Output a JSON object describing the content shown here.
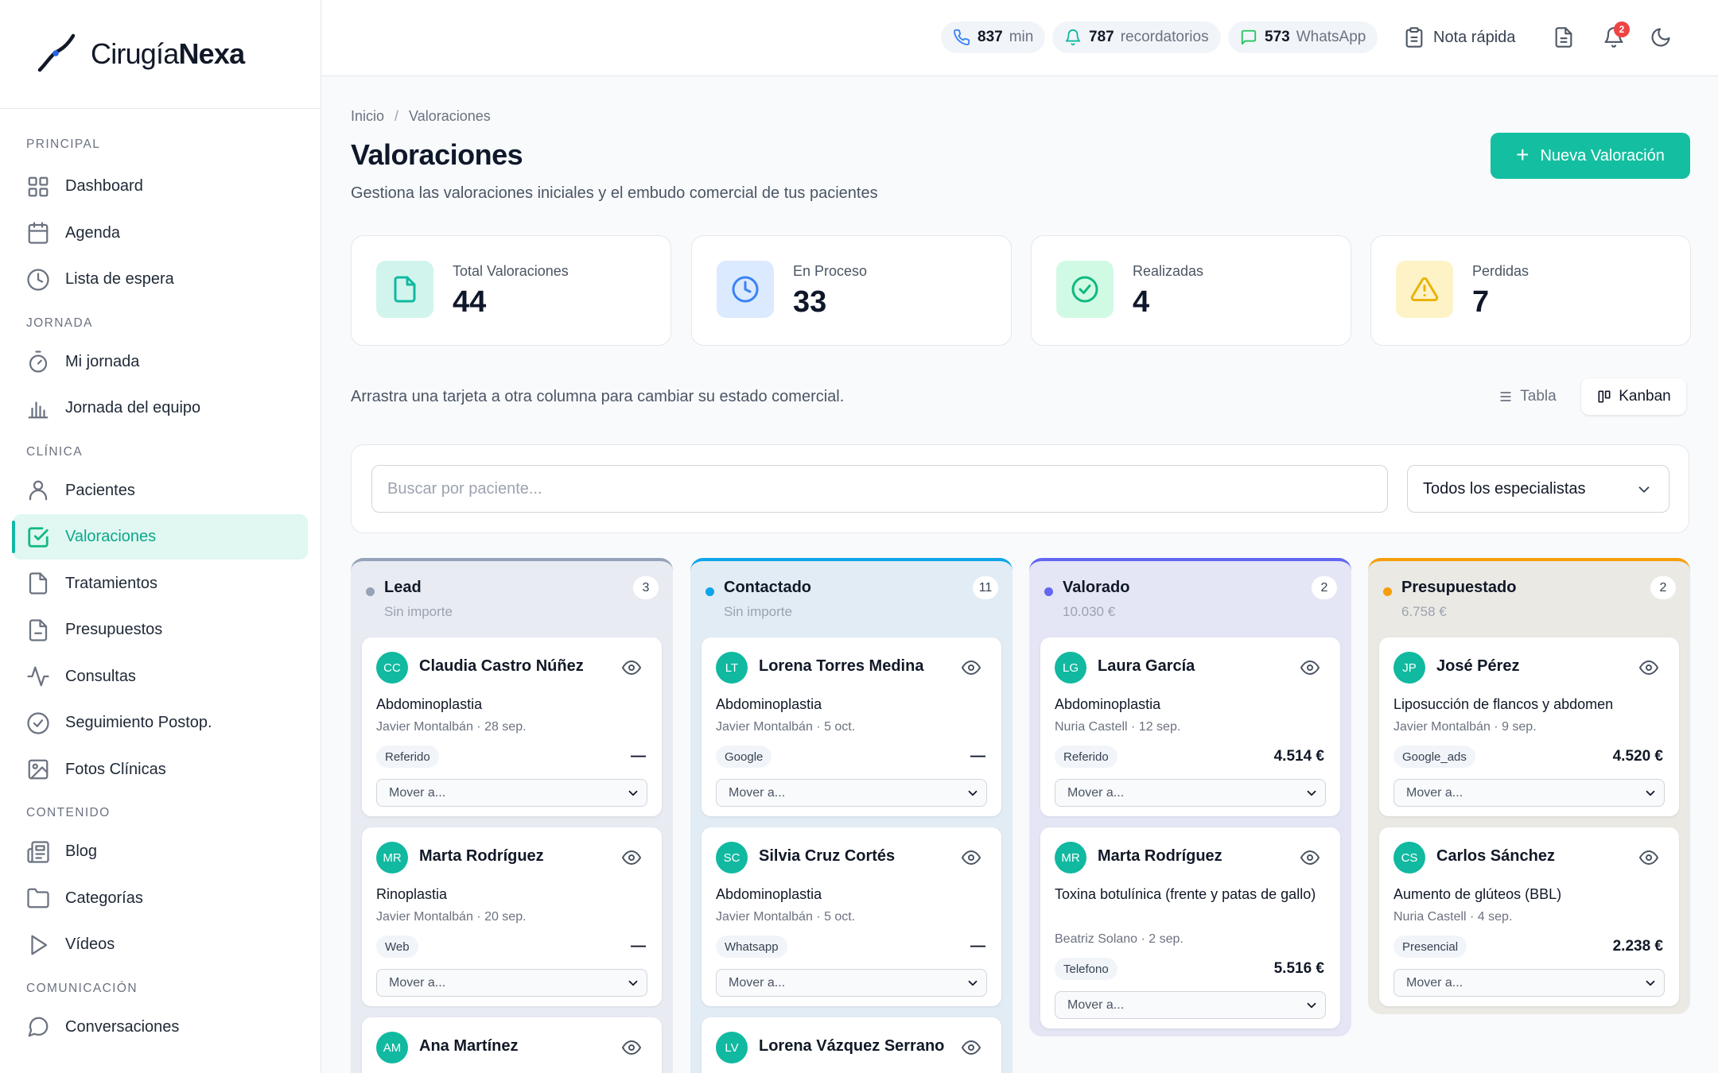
{
  "brand": {
    "name_light": "Cirugía",
    "name_bold": "Nexa"
  },
  "sidebar": {
    "sections": [
      {
        "title": "PRINCIPAL",
        "items": [
          {
            "label": "Dashboard",
            "icon": "dashboard-icon"
          },
          {
            "label": "Agenda",
            "icon": "calendar-icon"
          },
          {
            "label": "Lista de espera",
            "icon": "clock-icon"
          }
        ]
      },
      {
        "title": "JORNADA",
        "items": [
          {
            "label": "Mi jornada",
            "icon": "timer-icon"
          },
          {
            "label": "Jornada del equipo",
            "icon": "bar-chart-icon"
          }
        ]
      },
      {
        "title": "CLÍNICA",
        "items": [
          {
            "label": "Pacientes",
            "icon": "user-icon"
          },
          {
            "label": "Valoraciones",
            "icon": "check-square-icon",
            "active": true
          },
          {
            "label": "Tratamientos",
            "icon": "file-icon"
          },
          {
            "label": "Presupuestos",
            "icon": "file-minus-icon"
          },
          {
            "label": "Consultas",
            "icon": "activity-icon"
          },
          {
            "label": "Seguimiento Postop.",
            "icon": "check-circle-icon"
          },
          {
            "label": "Fotos Clínicas",
            "icon": "image-icon"
          }
        ]
      },
      {
        "title": "CONTENIDO",
        "items": [
          {
            "label": "Blog",
            "icon": "newspaper-icon"
          },
          {
            "label": "Categorías",
            "icon": "folder-icon"
          },
          {
            "label": "Vídeos",
            "icon": "play-icon"
          }
        ]
      },
      {
        "title": "COMUNICACIÓN",
        "items": [
          {
            "label": "Conversaciones",
            "icon": "chat-icon"
          }
        ]
      }
    ]
  },
  "topbar": {
    "minutes": {
      "value": "837",
      "unit": "min"
    },
    "reminders": {
      "value": "787",
      "unit": "recordatorios"
    },
    "whatsapp": {
      "value": "573",
      "unit": "WhatsApp"
    },
    "quick_note": "Nota rápida",
    "notifications_count": "2"
  },
  "page": {
    "breadcrumb": [
      "Inicio",
      "/",
      "Valoraciones"
    ],
    "title": "Valoraciones",
    "subtitle": "Gestiona las valoraciones iniciales y el embudo comercial de tus pacientes",
    "new_button": "Nueva Valoración",
    "hint": "Arrastra una tarjeta a otra columna para cambiar su estado comercial.",
    "view_table": "Tabla",
    "view_kanban": "Kanban",
    "search_placeholder": "Buscar por paciente...",
    "specialist_filter": "Todos los especialistas"
  },
  "stats": [
    {
      "label": "Total Valoraciones",
      "value": "44",
      "icon": "file-icon",
      "bg": "#d1f5ec",
      "fg": "#10b9a0"
    },
    {
      "label": "En Proceso",
      "value": "33",
      "icon": "clock-icon",
      "bg": "#dbeafe",
      "fg": "#3b82f6"
    },
    {
      "label": "Realizadas",
      "value": "4",
      "icon": "check-circle-icon",
      "bg": "#d1fae5",
      "fg": "#10b981"
    },
    {
      "label": "Perdidas",
      "value": "7",
      "icon": "warning-icon",
      "bg": "#fef3c7",
      "fg": "#eab308"
    }
  ],
  "kanban": {
    "move_placeholder": "Mover a...",
    "columns": [
      {
        "name": "Lead",
        "amount": "Sin importe",
        "count": "3",
        "accent": "#94a3b8",
        "bg": "#e8ebf2",
        "dot": "#94a3b8",
        "cards": [
          {
            "initials": "CC",
            "name": "Claudia Castro Núñez",
            "procedure": "Abdominoplastia",
            "meta": "Javier Montalbán · 28 sep.",
            "source": "Referido",
            "amount": "—"
          },
          {
            "initials": "MR",
            "name": "Marta Rodríguez",
            "procedure": "Rinoplastia",
            "meta": "Javier Montalbán · 20 sep.",
            "source": "Web",
            "amount": "—"
          },
          {
            "initials": "AM",
            "name": "Ana Martínez",
            "procedure": "",
            "meta": "",
            "source": "",
            "amount": ""
          }
        ]
      },
      {
        "name": "Contactado",
        "amount": "Sin importe",
        "count": "11",
        "accent": "#0ea5e9",
        "bg": "#e2ecf5",
        "dot": "#0ea5e9",
        "cards": [
          {
            "initials": "LT",
            "name": "Lorena Torres Medina",
            "procedure": "Abdominoplastia",
            "meta": "Javier Montalbán · 5 oct.",
            "source": "Google",
            "amount": "—"
          },
          {
            "initials": "SC",
            "name": "Silvia Cruz Cortés",
            "procedure": "Abdominoplastia",
            "meta": "Javier Montalbán · 5 oct.",
            "source": "Whatsapp",
            "amount": "—"
          },
          {
            "initials": "LV",
            "name": "Lorena Vázquez Serrano",
            "procedure": "",
            "meta": "",
            "source": "",
            "amount": ""
          }
        ]
      },
      {
        "name": "Valorado",
        "amount": "10.030 €",
        "count": "2",
        "accent": "#6366f1",
        "bg": "#e4e6f5",
        "dot": "#6366f1",
        "cards": [
          {
            "initials": "LG",
            "name": "Laura García",
            "procedure": "Abdominoplastia",
            "meta": "Nuria Castell · 12 sep.",
            "source": "Referido",
            "amount": "4.514 €"
          },
          {
            "initials": "MR",
            "name": "Marta Rodríguez",
            "procedure": "Toxina botulínica (frente y patas de gallo)",
            "meta": "Beatriz Solano · 2 sep.",
            "source": "Telefono",
            "amount": "5.516 €"
          }
        ]
      },
      {
        "name": "Presupuestado",
        "amount": "6.758 €",
        "count": "2",
        "accent": "#f59e0b",
        "bg": "#ebe9e4",
        "dot": "#f59e0b",
        "cards": [
          {
            "initials": "JP",
            "name": "José Pérez",
            "procedure": "Liposucción de flancos y abdomen",
            "meta": "Javier Montalbán · 9 sep.",
            "source": "Google_ads",
            "amount": "4.520 €"
          },
          {
            "initials": "CS",
            "name": "Carlos Sánchez",
            "procedure": "Aumento de glúteos (BBL)",
            "meta": "Nuria Castell · 4 sep.",
            "source": "Presencial",
            "amount": "2.238 €"
          }
        ]
      }
    ]
  }
}
